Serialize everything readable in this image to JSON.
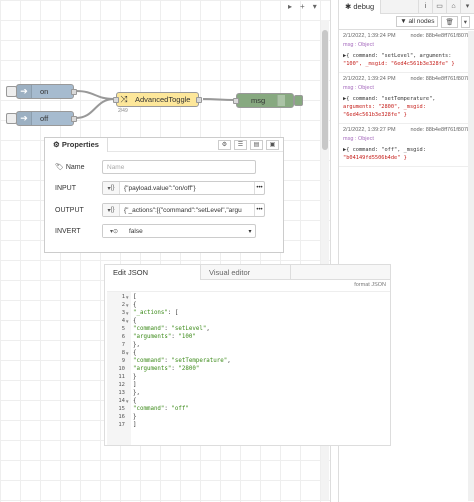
{
  "workspace": {
    "nodes": {
      "inject_on": {
        "label": "on"
      },
      "inject_off": {
        "label": "off"
      },
      "advanced_toggle": {
        "label": "AdvancedToggle",
        "sublabel": "2/49"
      },
      "debug": {
        "label": "msg"
      }
    }
  },
  "properties": {
    "tab_label": "Properties",
    "name": {
      "label": "Name",
      "placeholder": "Name"
    },
    "input": {
      "label": "INPUT",
      "type": "{}",
      "value": "{\"payload.value\":\"on/off\"}"
    },
    "output": {
      "label": "OUTPUT",
      "type": "{}",
      "value": "{\"_actions\":[{\"command\":\"setLevel\",\"argu"
    },
    "invert": {
      "label": "INVERT",
      "type": "⊙",
      "value": "false"
    }
  },
  "sidebar": {
    "tab_label": "debug",
    "filter_label": "all nodes",
    "messages": [
      {
        "timestamp": "2/1/2022, 1:39:24 PM",
        "node": "node: 88b4e8ff761f8078",
        "topic": "msg : Object",
        "payload_lines": [
          "▶{ command: \"setLevel\", arguments:",
          "\"100\", _msgid: \"6ed4c561b3e328fe\" }"
        ]
      },
      {
        "timestamp": "2/1/2022, 1:39:24 PM",
        "node": "node: 88b4e8ff761f8078",
        "topic": "msg : Object",
        "payload_lines": [
          "▶{ command: \"setTemperature\",",
          "arguments: \"2800\", _msgid:",
          "\"6ed4c561b3e328fe\" }"
        ]
      },
      {
        "timestamp": "2/1/2022, 1:39:27 PM",
        "node": "node: 88b4e8ff761f8078",
        "topic": "msg : Object",
        "payload_lines": [
          "▶{ command: \"off\", _msgid:",
          "\"b04149fd5506b4de\" }"
        ]
      }
    ]
  },
  "json_editor": {
    "tab_active": "Edit JSON",
    "tab_inactive": "Visual editor",
    "format_label": "format JSON",
    "lines": [
      {
        "n": "1",
        "fold": "▼",
        "text": "["
      },
      {
        "n": "2",
        "fold": "▼",
        "text": "  {"
      },
      {
        "n": "3",
        "fold": "▼",
        "text": "    \"_actions\": ["
      },
      {
        "n": "4",
        "fold": "▼",
        "text": "      {"
      },
      {
        "n": "5",
        "fold": "",
        "text": "        \"command\": \"setLevel\","
      },
      {
        "n": "6",
        "fold": "",
        "text": "        \"arguments\": \"100\""
      },
      {
        "n": "7",
        "fold": "",
        "text": "      },"
      },
      {
        "n": "8",
        "fold": "▼",
        "text": "      {"
      },
      {
        "n": "9",
        "fold": "",
        "text": "        \"command\": \"setTemperature\","
      },
      {
        "n": "10",
        "fold": "",
        "text": "        \"arguments\": \"2800\""
      },
      {
        "n": "11",
        "fold": "",
        "text": "      }"
      },
      {
        "n": "12",
        "fold": "",
        "text": "    ]"
      },
      {
        "n": "13",
        "fold": "",
        "text": "  },"
      },
      {
        "n": "14",
        "fold": "▼",
        "text": "  {"
      },
      {
        "n": "15",
        "fold": "",
        "text": "    \"command\": \"off\""
      },
      {
        "n": "16",
        "fold": "",
        "text": "  }"
      },
      {
        "n": "17",
        "fold": "",
        "text": "]"
      }
    ]
  }
}
